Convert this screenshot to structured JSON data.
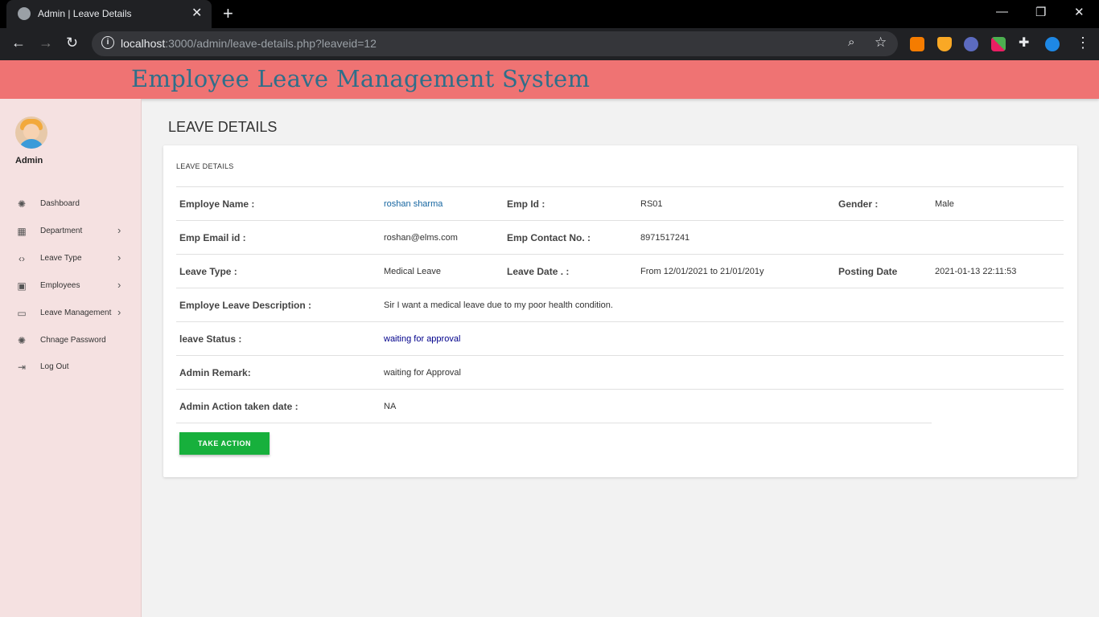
{
  "browser": {
    "tab_title": "Admin | Leave Details",
    "url_host": "localhost",
    "url_rest": ":3000/admin/leave-details.php?leaveid=12"
  },
  "app": {
    "title": "Employee Leave Management System"
  },
  "sidebar": {
    "user": "Admin",
    "items": [
      {
        "label": "Dashboard",
        "icon": "palette-icon",
        "has_submenu": false
      },
      {
        "label": "Department",
        "icon": "grid-icon",
        "has_submenu": true
      },
      {
        "label": "Leave Type",
        "icon": "code-icon",
        "has_submenu": true
      },
      {
        "label": "Employees",
        "icon": "account-box-icon",
        "has_submenu": true
      },
      {
        "label": "Leave Management",
        "icon": "desktop-icon",
        "has_submenu": true
      },
      {
        "label": "Chnage Password",
        "icon": "palette-icon",
        "has_submenu": false
      },
      {
        "label": "Log Out",
        "icon": "logout-icon",
        "has_submenu": false
      }
    ]
  },
  "page": {
    "title": "LEAVE DETAILS",
    "card_title": "LEAVE DETAILS"
  },
  "details": {
    "employee_name_label": "Employe Name :",
    "employee_name": "roshan sharma",
    "emp_id_label": "Emp Id :",
    "emp_id": "RS01",
    "gender_label": "Gender :",
    "gender": "Male",
    "email_label": "Emp Email id :",
    "email": "roshan@elms.com",
    "contact_label": "Emp Contact No. :",
    "contact": "8971517241",
    "leave_type_label": "Leave Type :",
    "leave_type": "Medical Leave",
    "leave_date_label": "Leave Date . :",
    "leave_date": "From 12/01/2021 to 21/01/201y",
    "posting_date_label": "Posting Date",
    "posting_date": "2021-01-13 22:11:53",
    "description_label": "Employe Leave Description :",
    "description": "Sir I want a medical leave due to my poor health condition.",
    "status_label": "leave Status :",
    "status": "waiting for approval",
    "admin_remark_label": "Admin Remark:",
    "admin_remark": "waiting for Approval",
    "action_date_label": "Admin Action taken date :",
    "action_date": "NA"
  },
  "actions": {
    "take_action": "TAKE ACTION"
  },
  "colors": {
    "header_bg": "#ef7373",
    "header_title": "#2e6f8a",
    "sidebar_bg": "#f5e1e1",
    "action_button": "#17b03c"
  }
}
